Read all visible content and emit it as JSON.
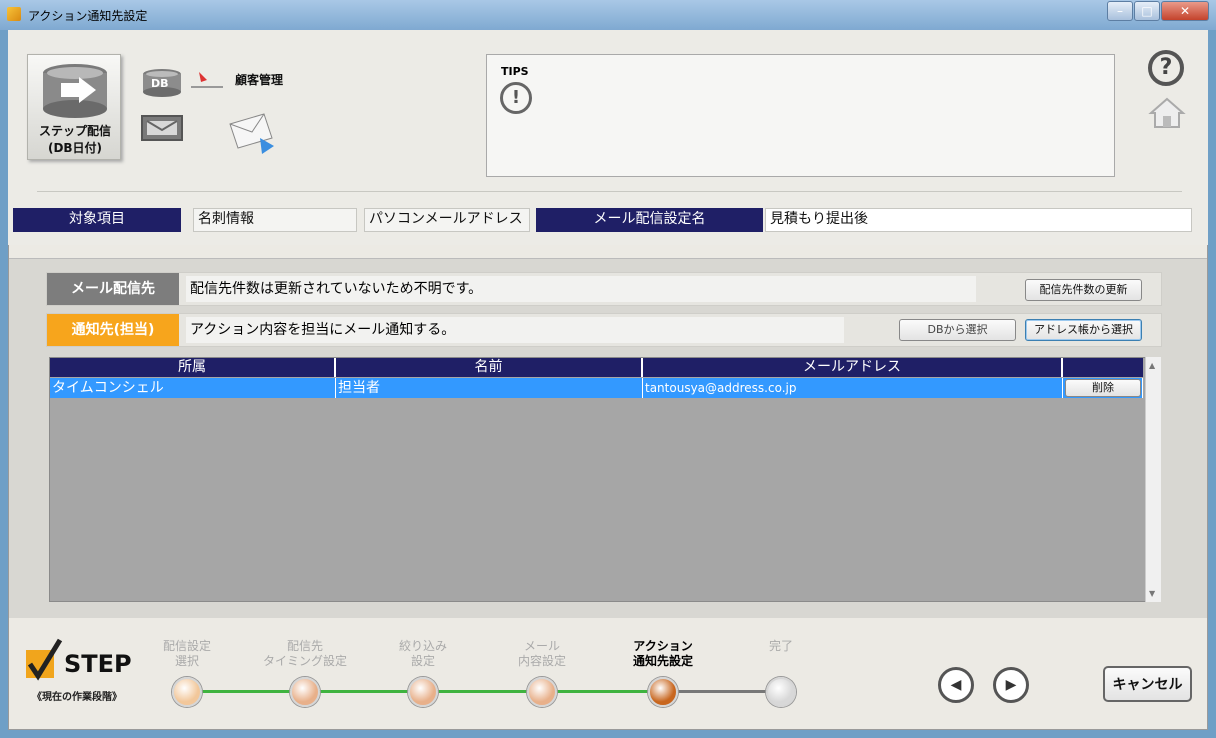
{
  "window": {
    "title": "アクション通知先設定",
    "minimize": "–",
    "maximize": "□",
    "close": "✕"
  },
  "step_tile": {
    "line1": "ステップ配信",
    "line2": "(DB日付)"
  },
  "db_icon_label": "DB",
  "db_name": "顧客管理",
  "tips": {
    "label": "TIPS",
    "text": ""
  },
  "header": {
    "target_label": "対象項目",
    "target_value1": "名刺情報",
    "target_value2": "パソコンメールアドレス",
    "setting_label": "メール配信設定名",
    "setting_value": "見積もり提出後"
  },
  "mail_delivery": {
    "label": "メール配信先",
    "text": "配信先件数は更新されていないため不明です。",
    "update_button": "配信先件数の更新"
  },
  "notify": {
    "label": "通知先(担当)",
    "text": "アクション内容を担当にメール通知する。",
    "db_button": "DBから選択",
    "address_button": "アドレス帳から選択"
  },
  "table": {
    "columns": [
      "所属",
      "名前",
      "メールアドレス",
      ""
    ],
    "rows": [
      {
        "affiliation": "タイムコンシェル",
        "name": "担当者",
        "email": "tantousya@address.co.jp",
        "action": "削除"
      }
    ]
  },
  "steps": {
    "logo": "STEP",
    "subtitle": "《現在の作業段階》",
    "items": [
      {
        "line1": "配信設定",
        "line2": "選択",
        "color": "#f2c79a"
      },
      {
        "line1": "配信先",
        "line2": "タイミング設定",
        "color": "#e8b08a"
      },
      {
        "line1": "絞り込み",
        "line2": "設定",
        "color": "#e8b08a"
      },
      {
        "line1": "メール",
        "line2": "内容設定",
        "color": "#e8b08a"
      },
      {
        "line1": "アクション",
        "line2": "通知先設定",
        "color": "#c8661e"
      },
      {
        "line1": "完了",
        "line2": "",
        "color": "#d8d8d8"
      }
    ],
    "active_index": 4
  },
  "cancel_button": "キャンセル"
}
